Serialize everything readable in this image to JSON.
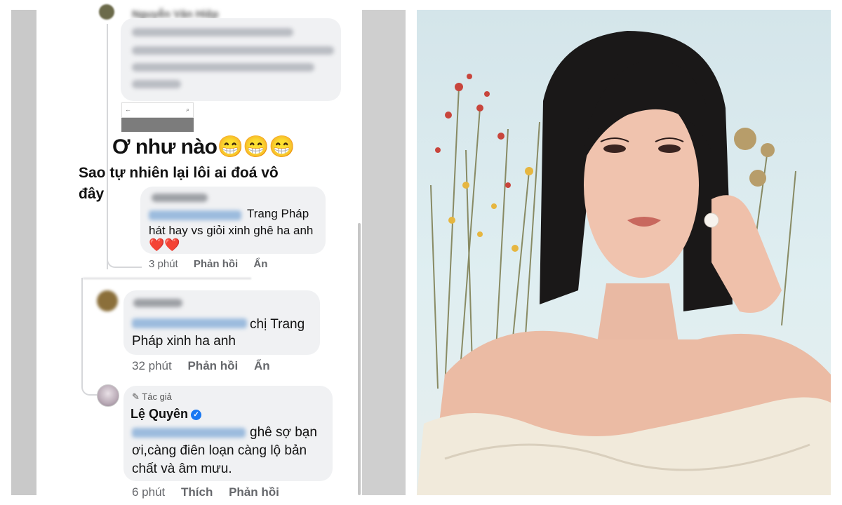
{
  "top_comment": {
    "name": "Nguyễn Văn Hiệp"
  },
  "overlay": {
    "line1": "Ơ như nào😁😁😁",
    "line2": "Sao tự nhiên lại lôi ai đoá vô đây"
  },
  "comment1": {
    "text_line1": "Trang Pháp",
    "text_line2": "hát hay vs giỏi xinh ghê ha anh",
    "hearts": "❤️❤️",
    "time": "3 phút",
    "reply": "Phản hồi",
    "hide": "Ẩn"
  },
  "comment2": {
    "text_line1": "chị Trang",
    "text_line2": "Pháp xinh ha anh",
    "time": "32 phút",
    "reply": "Phản hồi",
    "hide": "Ẩn"
  },
  "author_comment": {
    "badge": "Tác giả",
    "name": "Lệ Quyên",
    "text_line1": "ghê sợ bạn",
    "text_line2": "ơi,càng điên loạn càng lộ bản",
    "text_line3": "chất và âm mưu.",
    "time": "6 phút",
    "like": "Thích",
    "reply": "Phản hồi"
  },
  "colors": {
    "verified": "#1877f2",
    "bubble": "#f0f1f3",
    "meta_text": "#65676b"
  }
}
